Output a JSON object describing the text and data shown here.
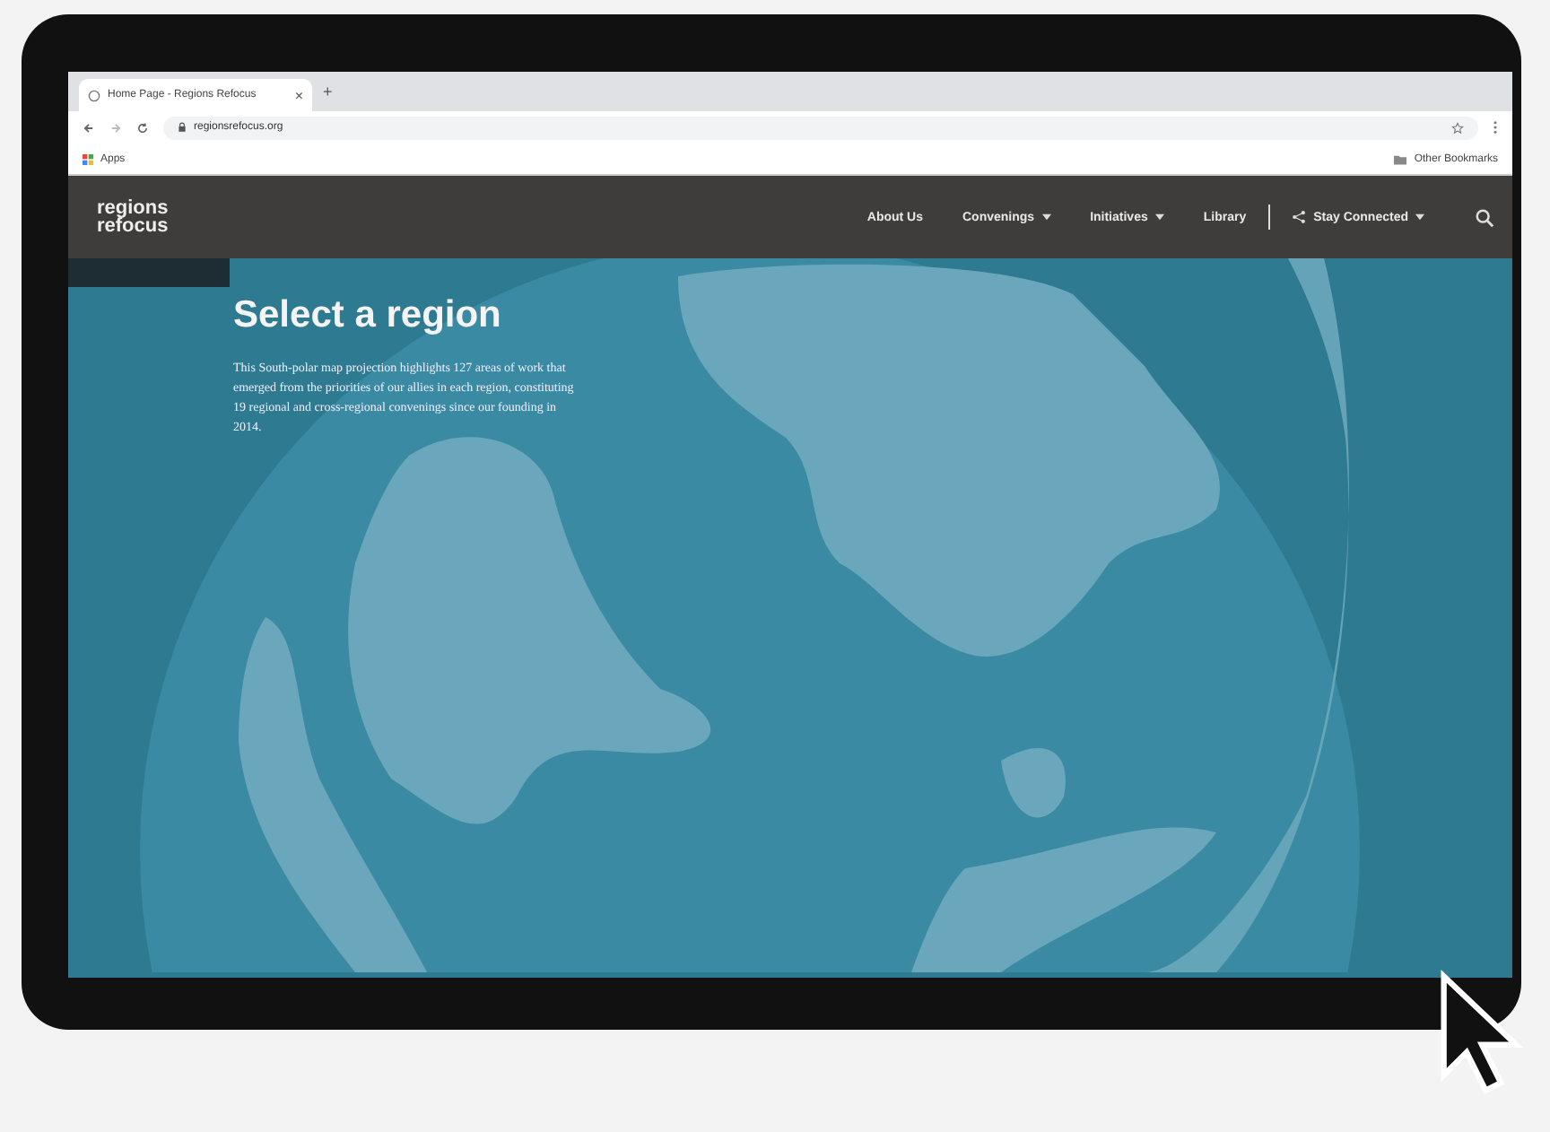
{
  "browser": {
    "tab_title": "Home Page - Regions Refocus",
    "tab_close": "×",
    "new_tab": "+",
    "url": "regionsrefocus.org",
    "bookmarks": [
      {
        "label": "Apps"
      }
    ],
    "other_bookmarks": "Other Bookmarks"
  },
  "site": {
    "logo": [
      "regions",
      "refocus"
    ],
    "nav": [
      {
        "label": "About Us",
        "dropdown": false
      },
      {
        "label": "Convenings",
        "dropdown": true
      },
      {
        "label": "Initiatives",
        "dropdown": true
      },
      {
        "label": "Library",
        "dropdown": false
      }
    ],
    "stay_connected": {
      "label": "Stay Connected",
      "dropdown": true
    }
  },
  "hero": {
    "title": "Select a region",
    "text": "This South-polar map projection highlights 127 areas of work that emerged from the priorities of our allies in each region, constituting 19 regional and cross-regional convenings since our founding in 2014."
  }
}
